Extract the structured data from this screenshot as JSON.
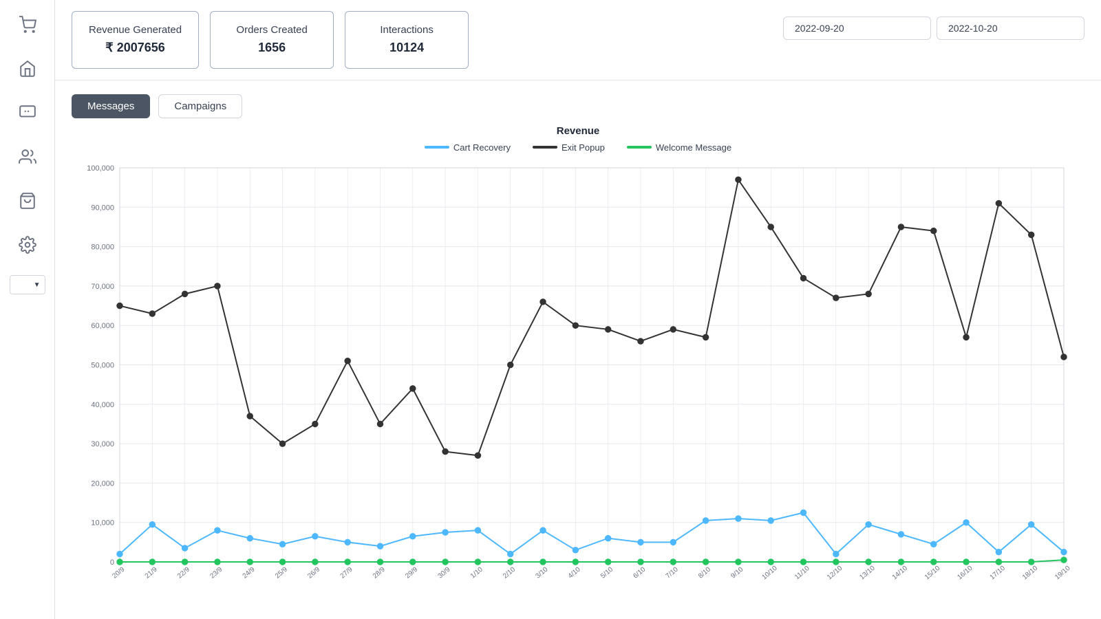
{
  "sidebar": {
    "icons": [
      {
        "name": "cart-icon",
        "symbol": "🛒"
      },
      {
        "name": "home-icon",
        "symbol": "🏠"
      },
      {
        "name": "chat-icon",
        "symbol": "💬"
      },
      {
        "name": "user-icon",
        "symbol": "👤"
      },
      {
        "name": "basket-icon",
        "symbol": "🧺"
      },
      {
        "name": "settings-icon",
        "symbol": "⚙️"
      }
    ],
    "dropdown_label": ""
  },
  "header": {
    "stats": [
      {
        "label": "Revenue Generated",
        "value": "₹ 2007656"
      },
      {
        "label": "Orders Created",
        "value": "1656"
      },
      {
        "label": "Interactions",
        "value": "10124"
      }
    ],
    "date_start": "2022-09-20",
    "date_end": "2022-10-20"
  },
  "tabs": [
    {
      "label": "Messages",
      "active": true
    },
    {
      "label": "Campaigns",
      "active": false
    }
  ],
  "chart": {
    "title": "Revenue",
    "legend": [
      {
        "label": "Cart Recovery",
        "color": "#4db8ff",
        "type": "line"
      },
      {
        "label": "Exit Popup",
        "color": "#333333",
        "type": "line"
      },
      {
        "label": "Welcome Message",
        "color": "#22c55e",
        "type": "line"
      }
    ],
    "x_labels": [
      "20/9",
      "21/9",
      "22/9",
      "23/9",
      "24/9",
      "25/9",
      "26/9",
      "27/9",
      "28/9",
      "29/9",
      "30/9",
      "1/10",
      "2/10",
      "3/10",
      "4/10",
      "5/10",
      "6/10",
      "7/10",
      "8/10",
      "9/10",
      "10/10",
      "11/10",
      "12/10",
      "13/10",
      "14/10",
      "15/10",
      "16/10",
      "17/10",
      "18/10",
      "19/10"
    ],
    "y_labels": [
      "0",
      "10,000",
      "20,000",
      "30,000",
      "40,000",
      "50,000",
      "60,000",
      "70,000",
      "80,000",
      "90,000",
      "100,000"
    ],
    "series": {
      "exit_popup": [
        65000,
        63000,
        68000,
        70000,
        37000,
        30000,
        35000,
        51000,
        35000,
        44000,
        28000,
        27000,
        50000,
        66000,
        60000,
        59000,
        56000,
        59000,
        57000,
        97000,
        85000,
        72000,
        67000,
        68000,
        85000,
        84000,
        57000,
        91000,
        83000,
        52000
      ],
      "cart_recovery": [
        2000,
        9500,
        3500,
        8000,
        6000,
        4500,
        6500,
        5000,
        4000,
        6500,
        7500,
        8000,
        2000,
        8000,
        3000,
        6000,
        5000,
        5000,
        10500,
        11000,
        10500,
        12500,
        2000,
        9500,
        7000,
        4500,
        10000,
        2500,
        9500,
        2500
      ],
      "welcome_message": [
        0,
        0,
        0,
        0,
        0,
        0,
        0,
        0,
        0,
        0,
        0,
        0,
        0,
        0,
        0,
        0,
        0,
        0,
        0,
        0,
        0,
        0,
        0,
        0,
        0,
        0,
        0,
        0,
        0,
        500
      ]
    }
  }
}
